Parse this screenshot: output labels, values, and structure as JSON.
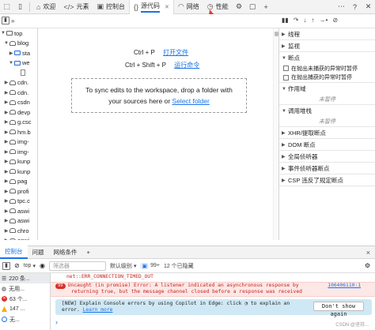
{
  "tabs": [
    {
      "label": "欢迎",
      "icon": "home-icon"
    },
    {
      "label": "元素",
      "icon": "elements-icon"
    },
    {
      "label": "控制台",
      "icon": "console-icon"
    },
    {
      "label": "源代码",
      "icon": "sources-icon",
      "active": true
    },
    {
      "label": "网络",
      "icon": "wifi-icon"
    },
    {
      "label": "性能",
      "icon": "performance-icon"
    }
  ],
  "tree": {
    "items": [
      {
        "label": "top",
        "kind": "root"
      },
      {
        "label": "blog",
        "kind": "cloud"
      },
      {
        "label": "sta",
        "kind": "folder"
      },
      {
        "label": "we",
        "kind": "folder-open"
      },
      {
        "label": "",
        "kind": "file"
      },
      {
        "label": "cdn.",
        "kind": "cloud"
      },
      {
        "label": "cdn.",
        "kind": "cloud"
      },
      {
        "label": "csdn",
        "kind": "cloud"
      },
      {
        "label": "devp",
        "kind": "cloud"
      },
      {
        "label": "g.csc",
        "kind": "cloud"
      },
      {
        "label": "hm.b",
        "kind": "cloud"
      },
      {
        "label": "img-",
        "kind": "cloud"
      },
      {
        "label": "img-",
        "kind": "cloud"
      },
      {
        "label": "kunp",
        "kind": "cloud"
      },
      {
        "label": "kunp",
        "kind": "cloud"
      },
      {
        "label": "pag",
        "kind": "cloud"
      },
      {
        "label": "profi",
        "kind": "cloud"
      },
      {
        "label": "tpc.c",
        "kind": "cloud"
      },
      {
        "label": "aswi",
        "kind": "cloud"
      },
      {
        "label": "aswi",
        "kind": "cloud"
      },
      {
        "label": "chro",
        "kind": "cloud"
      },
      {
        "label": "aswi",
        "kind": "cloud"
      }
    ]
  },
  "editor": {
    "shortcut1_key": "Ctrl + P",
    "shortcut1_action": "打开文件",
    "shortcut2_key": "Ctrl + Shift + P",
    "shortcut2_action": "运行命令",
    "drop_text_line1": "To sync edits to the workspace, drop a folder with",
    "drop_text_line2": "your sources here or",
    "drop_link": "Select folder"
  },
  "sidebar": {
    "threads": "线程",
    "watch": "监视",
    "breakpoints": "断点",
    "pause_uncaught": "在抛出未捕获的异常时暂停",
    "pause_caught": "在抛出捕获的异常时暂停",
    "scope": "作用域",
    "not_paused_1": "未暂停",
    "call_stack": "调用堆栈",
    "not_paused_2": "未暂停",
    "xhr": "XHR/提取断点",
    "dom": "DOM 断点",
    "global": "全局侦听器",
    "event": "事件侦听器断点",
    "csp": "CSP 违反了规定断点"
  },
  "drawer": {
    "tabs": [
      "控制台",
      "问题",
      "网络条件"
    ],
    "add": "+",
    "close": "×"
  },
  "console_toolbar": {
    "context": "top",
    "filter_placeholder": "筛选器",
    "level": "默认级别",
    "count_label": "99+",
    "hidden": "12 个已隐藏"
  },
  "console_side": [
    {
      "text": "220 条..."
    },
    {
      "text": "无用..."
    },
    {
      "text": "63 个..."
    },
    {
      "text": "147 ..."
    },
    {
      "text": "无..."
    }
  ],
  "console_msgs": {
    "line1": "net::ERR_CONNECTION_TIMED_OUT",
    "err_count": "99",
    "err_text1": "Uncaught (in promise) Error: A listener indicated an asynchronous response by",
    "err_src": "106406110:1",
    "err_text2": "returning true, but the message channel closed before a response was received",
    "banner_line1a": "[NEW] Explain Console errors by using Copilot in Edge: click",
    "banner_line1b": "to explain an",
    "banner_line2a": "error.",
    "banner_link": "Learn more",
    "banner_btn": "Don't show again",
    "prompt": "›",
    "watermark": "CSDN @坚持..."
  }
}
